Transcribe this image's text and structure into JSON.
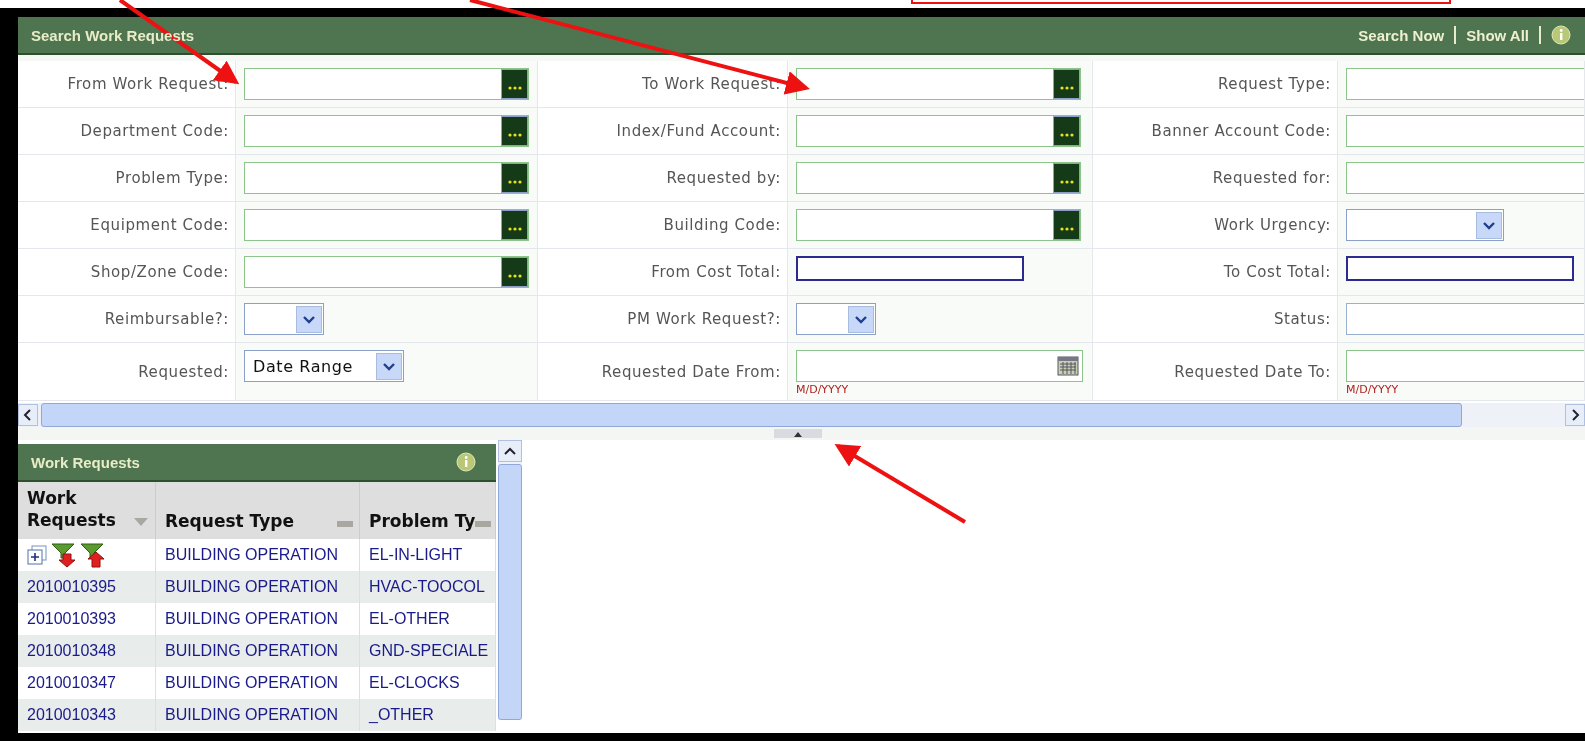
{
  "search_panel": {
    "title": "Search Work Requests",
    "actions": [
      "Search Now",
      "Show All"
    ],
    "rows": [
      [
        {
          "label": "From Work Request:",
          "field": {
            "kind": "lookup"
          }
        },
        {
          "label": "To Work Request:",
          "field": {
            "kind": "lookup"
          }
        },
        {
          "label": "Request Type:",
          "field": {
            "kind": "text"
          }
        }
      ],
      [
        {
          "label": "Department Code:",
          "field": {
            "kind": "lookup"
          }
        },
        {
          "label": "Index/Fund Account:",
          "field": {
            "kind": "lookup"
          }
        },
        {
          "label": "Banner Account Code:",
          "field": {
            "kind": "text"
          }
        }
      ],
      [
        {
          "label": "Problem Type:",
          "field": {
            "kind": "lookup"
          }
        },
        {
          "label": "Requested by:",
          "field": {
            "kind": "lookup"
          }
        },
        {
          "label": "Requested for:",
          "field": {
            "kind": "text"
          }
        }
      ],
      [
        {
          "label": "Equipment Code:",
          "field": {
            "kind": "lookup"
          }
        },
        {
          "label": "Building Code:",
          "field": {
            "kind": "lookup"
          }
        },
        {
          "label": "Work Urgency:",
          "field": {
            "kind": "select"
          }
        }
      ],
      [
        {
          "label": "Shop/Zone Code:",
          "field": {
            "kind": "lookup"
          }
        },
        {
          "label": "From Cost Total:",
          "field": {
            "kind": "number"
          }
        },
        {
          "label": "To Cost Total:",
          "field": {
            "kind": "number"
          }
        }
      ],
      [
        {
          "label": "Reimbursable?:",
          "field": {
            "kind": "select"
          }
        },
        {
          "label": "PM Work Request?:",
          "field": {
            "kind": "select"
          }
        },
        {
          "label": "Status:",
          "field": {
            "kind": "plain"
          }
        }
      ],
      [
        {
          "label": "Requested:",
          "field": {
            "kind": "select",
            "value": "Date Range"
          }
        },
        {
          "label": "Requested Date From:",
          "field": {
            "kind": "date",
            "hint": "M/D/YYYY"
          }
        },
        {
          "label": "Requested Date To:",
          "field": {
            "kind": "text",
            "hint": "M/D/YYYY"
          }
        }
      ]
    ]
  },
  "results_panel": {
    "title": "Work Requests",
    "columns": [
      {
        "label": "Work Requests",
        "sorted": true
      },
      {
        "label": "Request Type",
        "sorted": false
      },
      {
        "label": "Problem Ty",
        "sorted": false
      }
    ],
    "rows": [
      {
        "kind": "filter",
        "cells": [
          "",
          "BUILDING OPERATION",
          "EL-IN-LIGHT"
        ]
      },
      {
        "kind": "data",
        "cells": [
          "2010010395",
          "BUILDING OPERATION",
          "HVAC-TOOCOL"
        ]
      },
      {
        "kind": "data",
        "cells": [
          "2010010393",
          "BUILDING OPERATION",
          "EL-OTHER"
        ]
      },
      {
        "kind": "data",
        "cells": [
          "2010010348",
          "BUILDING OPERATION",
          "GND-SPECIALE"
        ]
      },
      {
        "kind": "data",
        "cells": [
          "2010010347",
          "BUILDING OPERATION",
          "EL-CLOCKS"
        ]
      },
      {
        "kind": "data",
        "cells": [
          "2010010343",
          "BUILDING OPERATION",
          "_OTHER"
        ]
      }
    ]
  }
}
